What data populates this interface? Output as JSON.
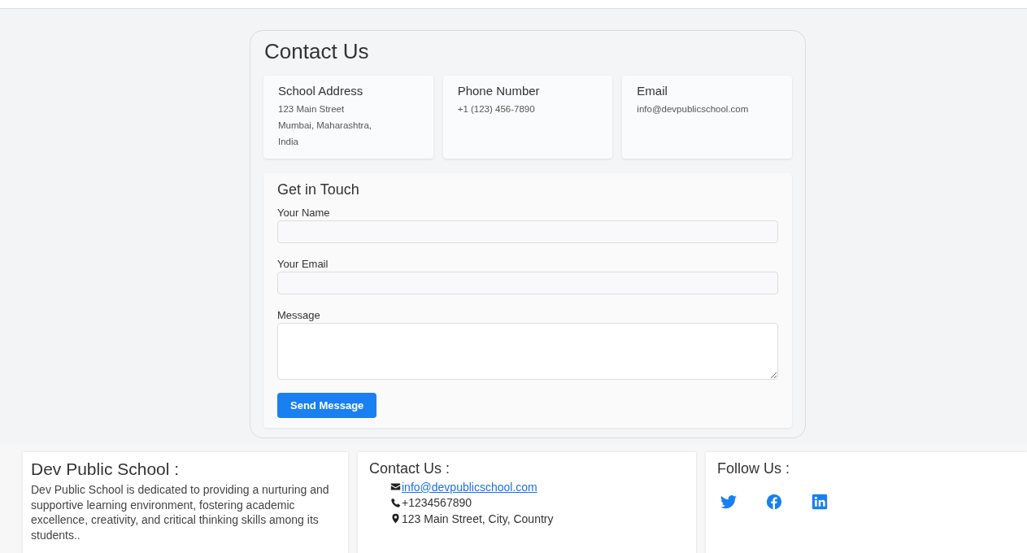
{
  "contact": {
    "title": "Contact Us",
    "info_cards": [
      {
        "heading": "School Address",
        "lines": [
          "123 Main Street",
          "Mumbai, Maharashtra,",
          "India"
        ]
      },
      {
        "heading": "Phone Number",
        "lines": [
          "+1 (123) 456-7890"
        ]
      },
      {
        "heading": "Email",
        "lines": [
          "info@devpublicschool.com"
        ]
      }
    ],
    "form": {
      "title": "Get in Touch",
      "fields": [
        {
          "label": "Your Name",
          "kind": "input"
        },
        {
          "label": "Your Email",
          "kind": "input"
        },
        {
          "label": "Message",
          "kind": "textarea"
        }
      ],
      "submit": "Send Message"
    }
  },
  "footer": {
    "about": {
      "title": "Dev Public School :",
      "text": "Dev Public School is dedicated to providing a nurturing and supportive learning environment, fostering academic excellence, creativity, and critical thinking skills among its students.."
    },
    "contact": {
      "title": "Contact Us :",
      "items": [
        {
          "kind": "email",
          "text": "info@devpublicschool.com"
        },
        {
          "kind": "phone",
          "text": "+1234567890"
        },
        {
          "kind": "location",
          "text": "123 Main Street, City, Country"
        }
      ]
    },
    "follow": {
      "title": "Follow Us :",
      "links": [
        {
          "kind": "bird"
        },
        {
          "kind": "facebook"
        },
        {
          "kind": "linkedin"
        }
      ]
    }
  }
}
